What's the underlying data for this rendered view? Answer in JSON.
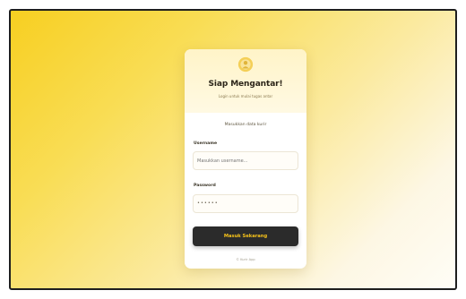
{
  "login": {
    "title": "Siap Mengantar!",
    "subtitle": "Login untuk mulai tugas antar",
    "note": "Masukkan data kurir",
    "username_label": "Username",
    "username_placeholder": "Masukkan username...",
    "password_label": "Password",
    "password_value": "••••••",
    "submit_label": "Masuk Sekarang",
    "footer": "© Kurir App"
  },
  "colors": {
    "accent": "#f7cf21",
    "button_bg": "#2b2b2b",
    "button_text": "#f6c21a"
  },
  "icons": {
    "logo": "courier-badge-icon"
  }
}
